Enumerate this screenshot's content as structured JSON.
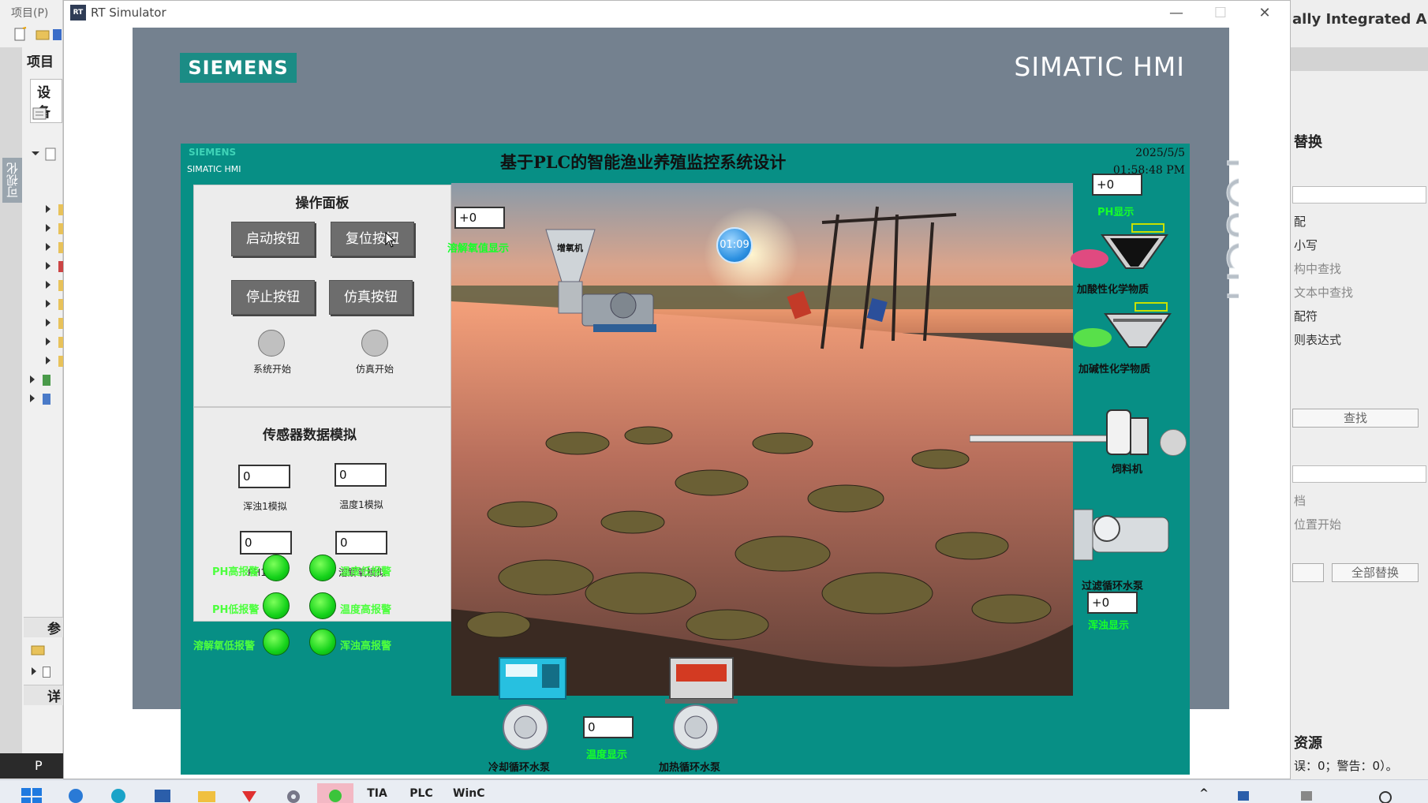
{
  "background_app": {
    "left_menu": "项目(P)",
    "left_sidebar_label": "可视化",
    "left_section_project": "项目",
    "left_tab_devices": "设备",
    "left_section_params": "参",
    "left_section_details": "详",
    "left_bottom": "P",
    "right_title": "ally Integrated Autom",
    "right_replace_heading": "替换",
    "right_options": [
      "配",
      "小写",
      "构中查找",
      "文本中查找",
      "配符",
      "则表达式"
    ],
    "right_find_button": "查找",
    "right_options2": [
      "档",
      "位置开始"
    ],
    "right_replace_all_button": "全部替换",
    "right_resources": "资源",
    "right_status": "误：0；警告：0）。"
  },
  "taskbar": {
    "apps": [
      "TIA",
      "PLC",
      "WinC"
    ]
  },
  "window": {
    "title": "RT Simulator",
    "minimize": "—",
    "maximize": "☐",
    "close": "✕"
  },
  "frame": {
    "brand": "SIEMENS",
    "product": "SIMATIC HMI",
    "panel_type": "TOUCH"
  },
  "screen": {
    "brand_small": "SIEMENS",
    "hmi_small": "SIMATIC HMI",
    "title": "基于PLC的智能渔业养殖监控系统设计",
    "date": "2025/5/5",
    "time": "01:58:48 PM",
    "timer": "01:09"
  },
  "operation_panel": {
    "title": "操作面板",
    "start_button": "启动按钮",
    "reset_button": "复位按钮",
    "stop_button": "停止按钮",
    "sim_button": "仿真按钮",
    "system_start_label": "系统开始",
    "sim_start_label": "仿真开始"
  },
  "sensor_panel": {
    "title": "传感器数据模拟",
    "turbidity_value": "0",
    "turbidity_label": "浑浊1模拟",
    "temp_value": "0",
    "temp_label": "温度1模拟",
    "ph_value": "0",
    "ph_label": "PH1模拟",
    "do_value": "0",
    "do_label": "溶解氧模拟"
  },
  "alarms": {
    "ph_high": "PH高报警",
    "ph_low": "PH低报警",
    "do_low": "溶解氧低报警",
    "temp_low": "温度低报警",
    "temp_high": "温度高报警",
    "turb_high": "浑浊高报警",
    "color": "#14d21a"
  },
  "displays": {
    "do_value": "+0",
    "do_label": "溶解氧值显示",
    "oxygen_machine": "增氧机",
    "ph_value": "+0",
    "ph_label": "PH显示",
    "acid_label": "加酸性化学物质",
    "alkali_label": "加碱性化学物质",
    "feeder_label": "饲料机",
    "filter_pump_label": "过滤循环水泵",
    "turb_value": "+0",
    "turb_label": "浑浊显示",
    "cool_pump_label": "冷却循环水泵",
    "temp_value": "0",
    "temp_label": "温度显示",
    "heat_pump_label": "加热循环水泵"
  },
  "colors": {
    "hmi_bg": "#078f85",
    "frame": "#74818f",
    "siemens_logo": "#1b8c85",
    "green_text": "#17ff2a"
  }
}
